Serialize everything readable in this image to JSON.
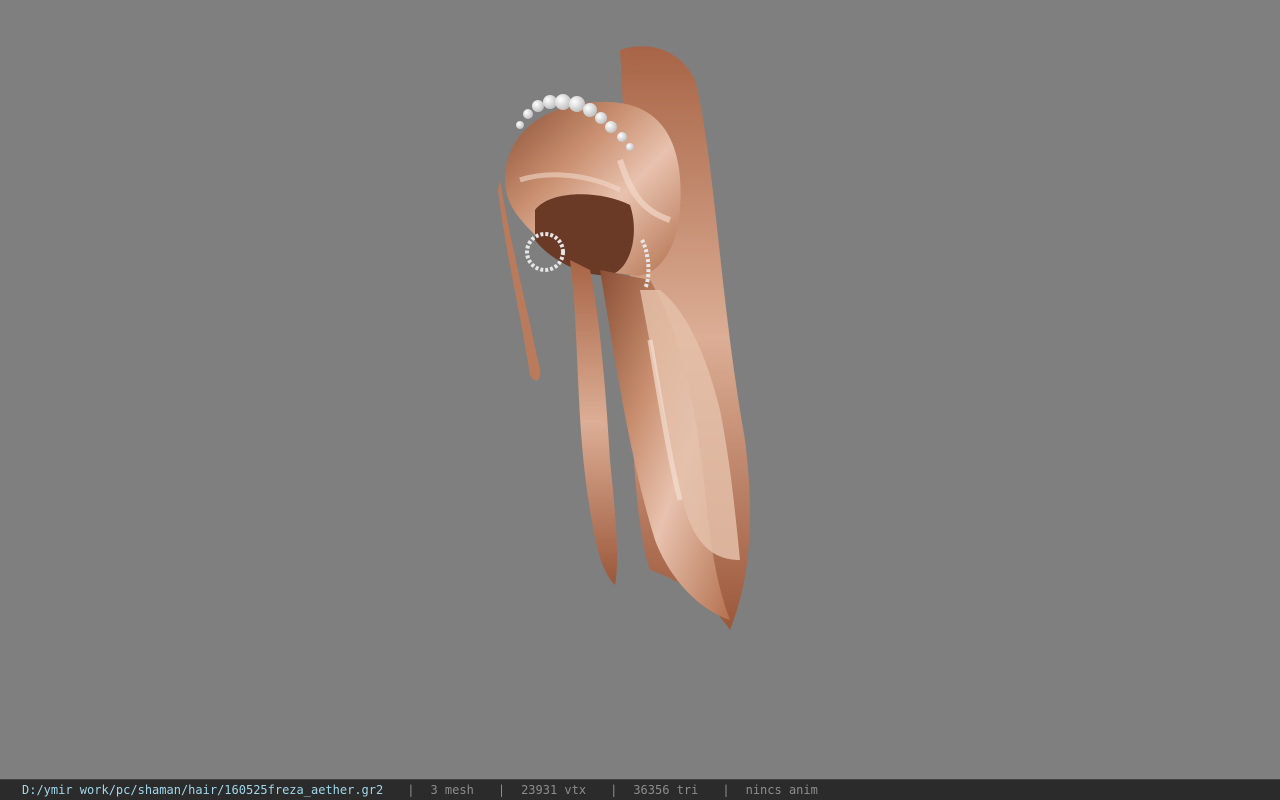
{
  "viewer": {
    "background_color": "#7f7f7f",
    "model_icon": "hair-model-3d"
  },
  "statusbar": {
    "file_path": "D:/ymir work/pc/shaman/hair/160525freza_aether.gr2",
    "separator": "|",
    "mesh_count": "3 mesh",
    "vertex_count": "23931 vtx",
    "triangle_count": "36356 tri",
    "anim_status": "nincs anim",
    "path_color": "#9fd6ea",
    "text_color": "#8c8c8c"
  }
}
